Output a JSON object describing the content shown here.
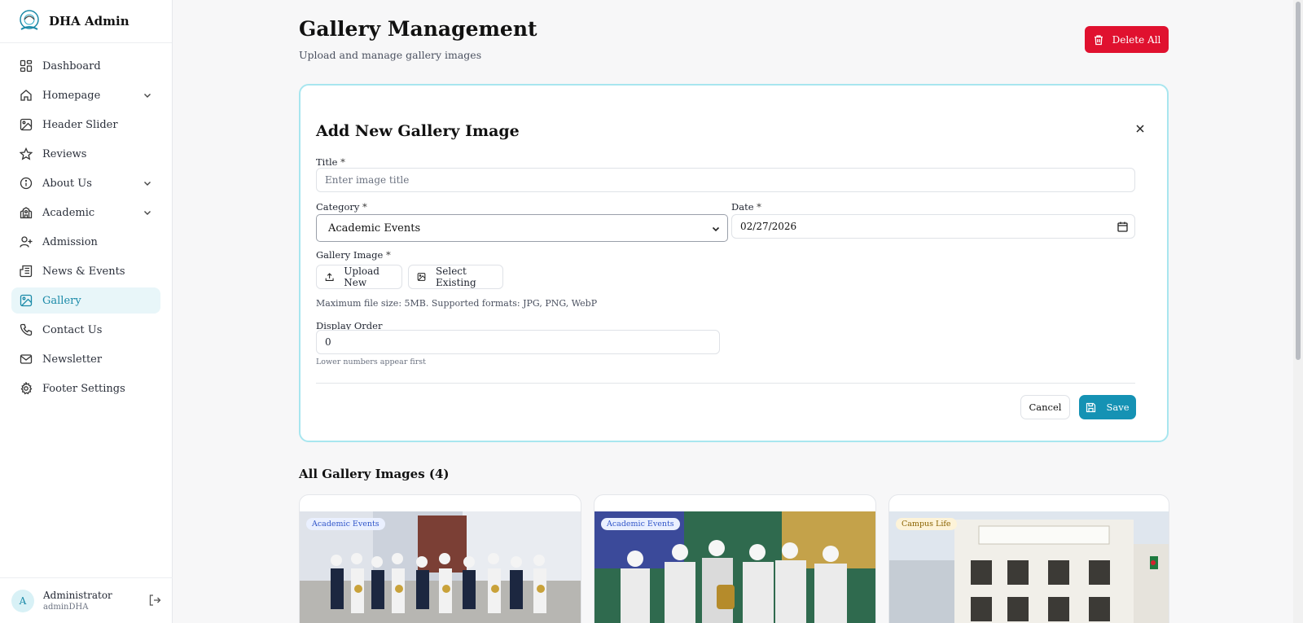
{
  "brand": {
    "name": "DHA Admin"
  },
  "sidebar": {
    "items": [
      {
        "label": "Dashboard",
        "icon": "dashboard-icon"
      },
      {
        "label": "Homepage",
        "icon": "home-icon"
      },
      {
        "label": "Header Slider",
        "icon": "image-icon"
      },
      {
        "label": "Reviews",
        "icon": "star-icon"
      },
      {
        "label": "About Us",
        "icon": "info-icon"
      },
      {
        "label": "Academic",
        "icon": "school-icon"
      },
      {
        "label": "Admission",
        "icon": "user-plus-icon"
      },
      {
        "label": "News & Events",
        "icon": "newspaper-icon"
      },
      {
        "label": "Gallery",
        "icon": "image-icon"
      },
      {
        "label": "Contact Us",
        "icon": "phone-icon"
      },
      {
        "label": "Newsletter",
        "icon": "mail-icon"
      },
      {
        "label": "Footer Settings",
        "icon": "gear-icon"
      }
    ],
    "active": "Gallery"
  },
  "user": {
    "initial": "A",
    "name": "Administrator",
    "handle": "adminDHA"
  },
  "header": {
    "title": "Gallery Management",
    "subtitle": "Upload and manage gallery images",
    "delete_all_label": "Delete All"
  },
  "form": {
    "title": "Add New Gallery Image",
    "title_label": "Title",
    "title_placeholder": "Enter image title",
    "category_label": "Category",
    "category_value": "Academic Events",
    "date_label": "Date",
    "date_value": "02/27/2026",
    "image_label": "Gallery Image",
    "upload_new_label": "Upload New",
    "select_existing_label": "Select Existing",
    "file_hint": "Maximum file size: 5MB. Supported formats: JPG, PNG, WebP",
    "order_label": "Display Order",
    "order_value": "0",
    "order_hint": "Lower numbers appear first",
    "required_mark": "*",
    "cancel_label": "Cancel",
    "save_label": "Save"
  },
  "gallery": {
    "title": "All Gallery Images (4)",
    "cards": [
      {
        "category": "Academic Events"
      },
      {
        "category": "Academic Events"
      },
      {
        "category": "Campus Life"
      }
    ]
  },
  "colors": {
    "accent": "#1592b4",
    "danger": "#e0112f",
    "active_bg": "#e8f6f9"
  }
}
